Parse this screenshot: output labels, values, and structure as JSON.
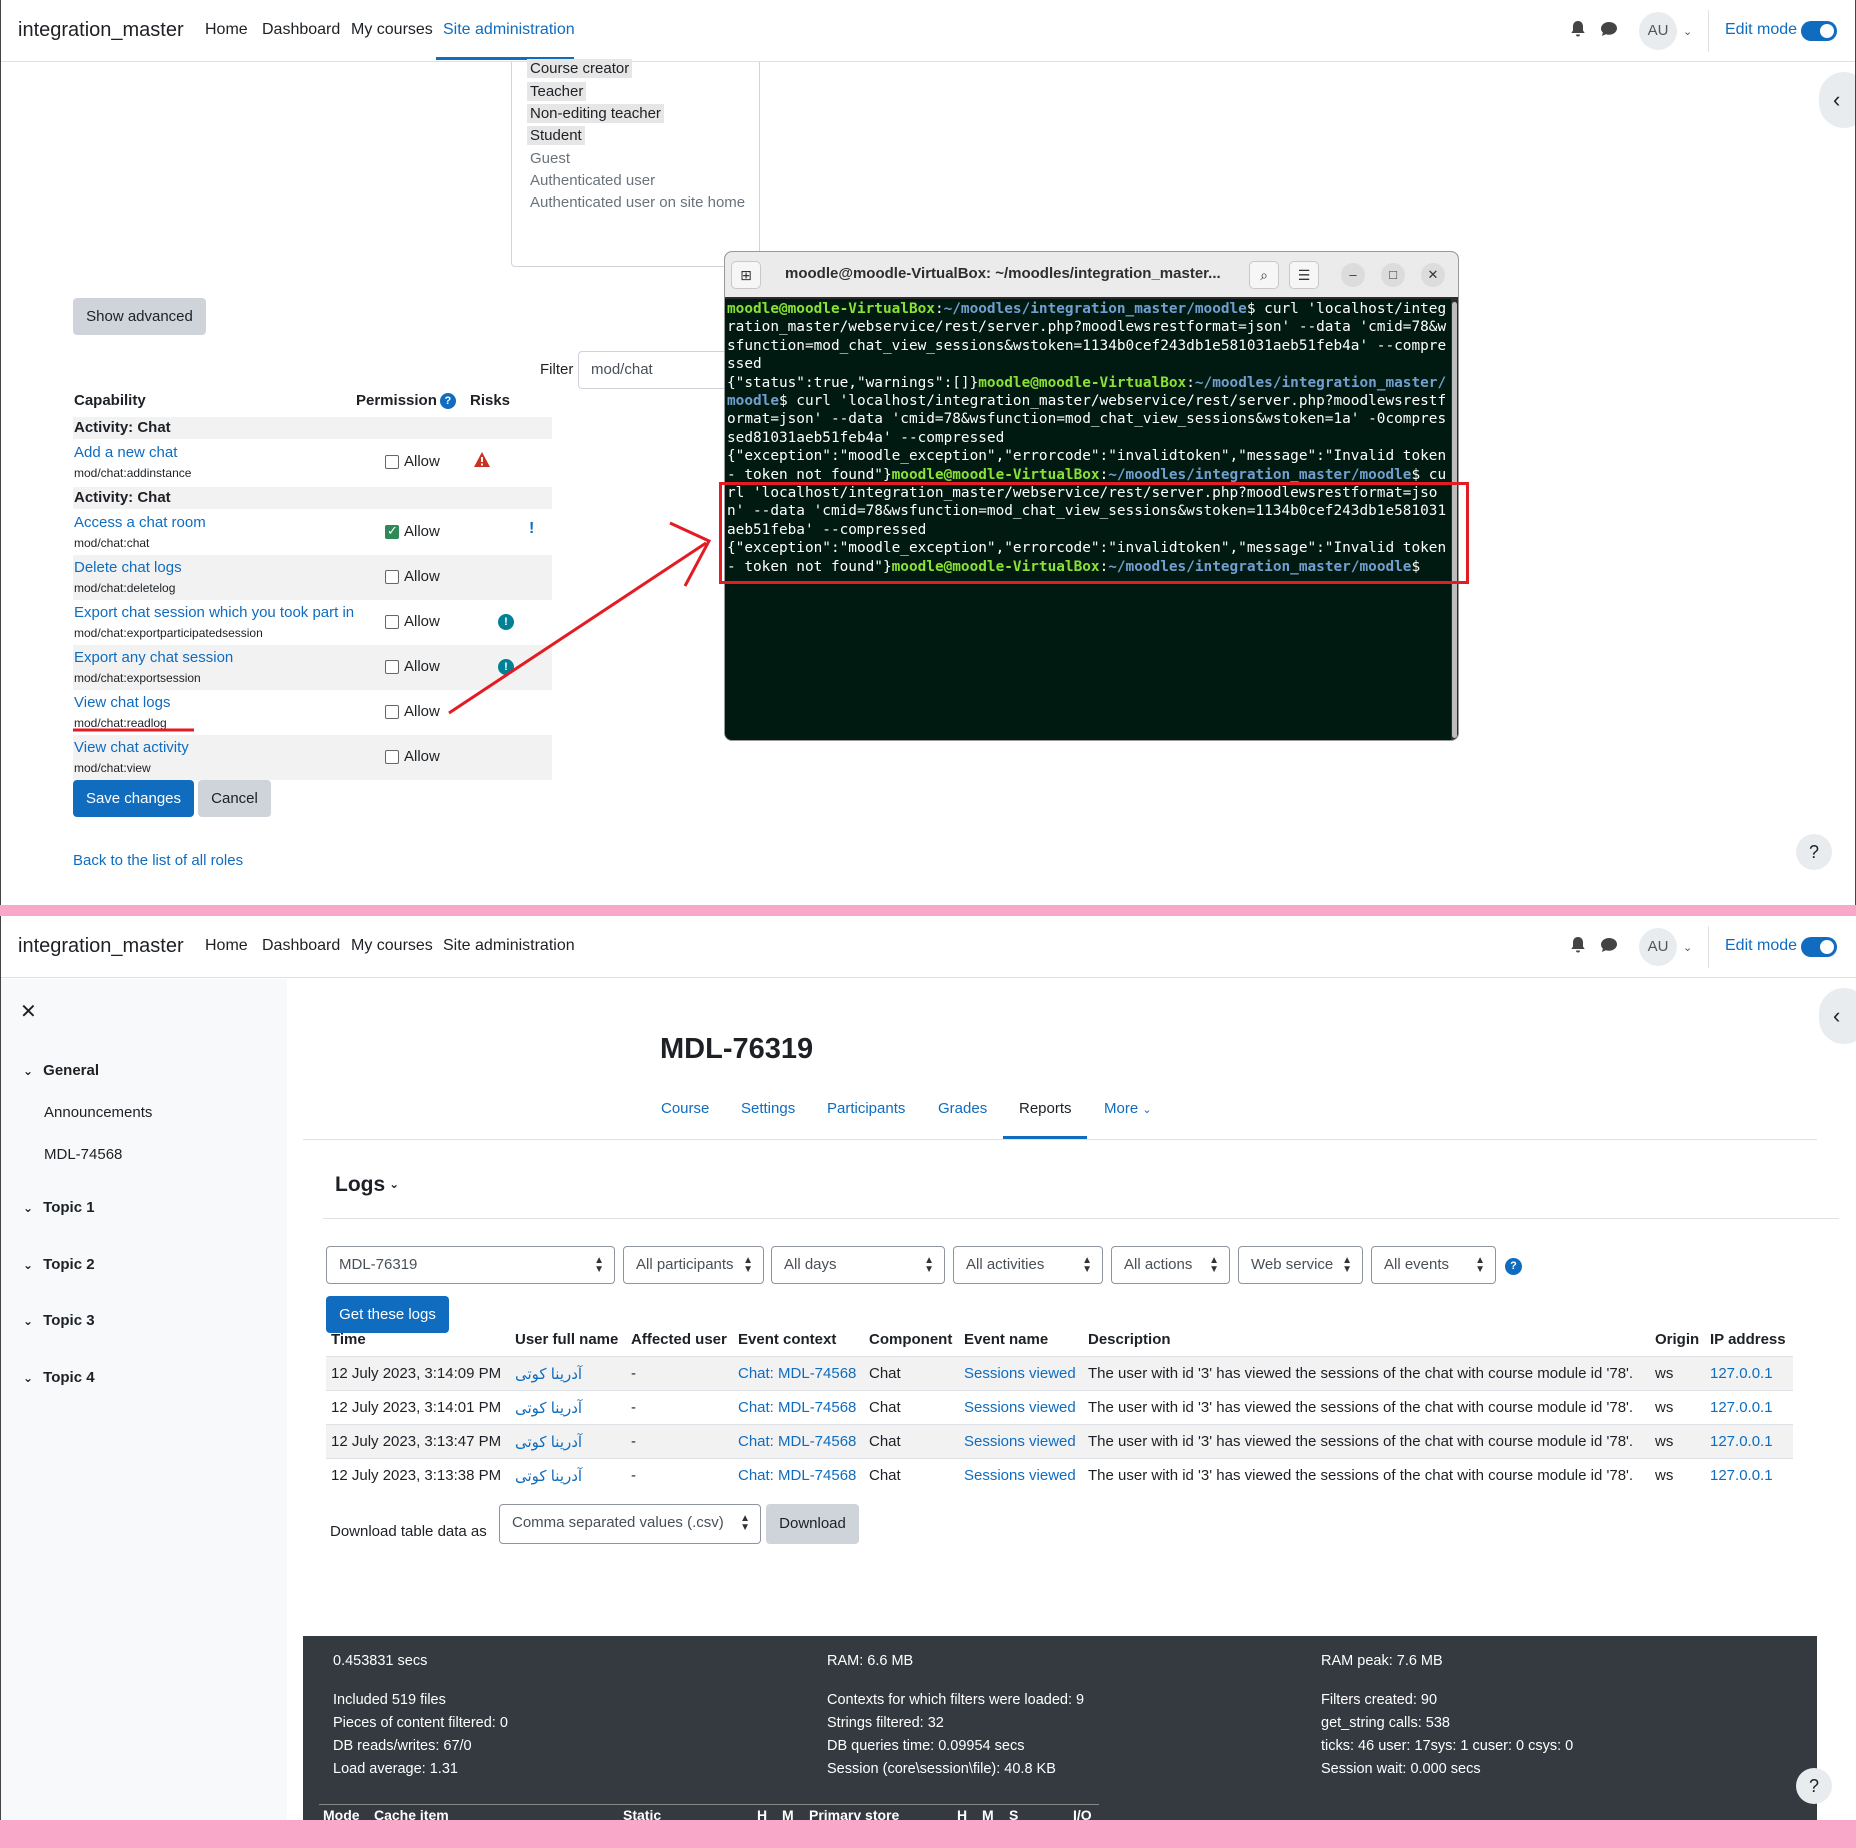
{
  "navbar": {
    "brand": "integration_master",
    "items": [
      "Home",
      "Dashboard",
      "My courses",
      "Site administration"
    ],
    "avatar": "AU",
    "edit_mode": "Edit mode"
  },
  "roles_list": {
    "selected": [
      "Course creator",
      "Teacher",
      "Non-editing teacher",
      "Student"
    ],
    "unselected": [
      "Guest",
      "Authenticated user",
      "Authenticated user on site home"
    ]
  },
  "capabilities": {
    "show_advanced": "Show advanced",
    "filter_label": "Filter",
    "filter_value": "mod/chat",
    "col_capability": "Capability",
    "col_permission": "Permission",
    "col_risks": "Risks",
    "group_label": "Activity: Chat",
    "allow_label": "Allow",
    "rows": [
      {
        "name": "Add a new chat",
        "code": "mod/chat:addinstance",
        "checked": false,
        "risk": "warning"
      },
      {
        "name": "Access a chat room",
        "code": "mod/chat:chat",
        "checked": true,
        "risk": "!"
      },
      {
        "name": "Delete chat logs",
        "code": "mod/chat:deletelog",
        "checked": false,
        "risk": ""
      },
      {
        "name": "Export chat session which you took part in",
        "code": "mod/chat:exportparticipatedsession",
        "checked": false,
        "risk": "info"
      },
      {
        "name": "Export any chat session",
        "code": "mod/chat:exportsession",
        "checked": false,
        "risk": "info"
      },
      {
        "name": "View chat logs",
        "code": "mod/chat:readlog",
        "checked": false,
        "risk": ""
      },
      {
        "name": "View chat activity",
        "code": "mod/chat:view",
        "checked": false,
        "risk": ""
      }
    ],
    "save": "Save changes",
    "cancel": "Cancel",
    "back_link": "Back to the list of all roles"
  },
  "terminal": {
    "title": "moodle@moodle-VirtualBox: ~/moodles/integration_master...",
    "prompt_user": "moodle@moodle-VirtualBox",
    "path_1": "~/moodles/integration_master/moodle",
    "path_2": "~/moodles/integration_master/moodle",
    "cmd_1": "$ curl 'localhost/integration_master/webservice/rest/server.php?moodlewsrestformat=json' --data 'cmid=78&wsfunction=mod_chat_view_sessions&wstoken=1134b0cef243db1e581031aeb51feb4a' --compressed",
    "out_1": "{\"status\":true,\"warnings\":[]}",
    "cmd_2": "$ curl 'localhost/integration_master/webservice/rest/server.php?moodlewsrestformat=json' --data 'cmid=78&wsfunction=mod_chat_view_sessions&wstoken=1a' -0compressed81031aeb51feb4a' --compressed",
    "out_2": "{\"exception\":\"moodle_exception\",\"errorcode\":\"invalidtoken\",\"message\":\"Invalid token - token not found\"}",
    "cmd_3": "$ curl 'localhost/integration_master/webservice/rest/server.php?moodlewsrestformat=json' --data 'cmid=78&wsfunction=mod_chat_view_sessions&wstoken=1134b0cef243db1e581031aeb51feba' --compressed",
    "out_3": "{\"exception\":\"moodle_exception\",\"errorcode\":\"invalidtoken\",\"message\":\"Invalid token - token not found\"}",
    "tail": "$"
  },
  "drawer": {
    "sections": [
      "General",
      "Topic 1",
      "Topic 2",
      "Topic 3",
      "Topic 4"
    ],
    "general_items": [
      "Announcements",
      "MDL-74568"
    ]
  },
  "course": {
    "title": "MDL-76319",
    "tabs": [
      "Course",
      "Settings",
      "Participants",
      "Grades",
      "Reports",
      "More"
    ]
  },
  "logs": {
    "heading": "Logs",
    "filters": [
      "MDL-76319",
      "All participants",
      "All days",
      "All activities",
      "All actions",
      "Web service",
      "All events"
    ],
    "get_button": "Get these logs",
    "columns": [
      "Time",
      "User full name",
      "Affected user",
      "Event context",
      "Component",
      "Event name",
      "Description",
      "Origin",
      "IP address"
    ],
    "rows": [
      {
        "time": "12 July 2023, 3:14:09 PM",
        "user": "آدرینا کوتی",
        "affected": "-",
        "context": "Chat: MDL-74568",
        "component": "Chat",
        "event": "Sessions viewed",
        "description": "The user with id '3' has viewed the sessions of the chat with course module id '78'.",
        "origin": "ws",
        "ip": "127.0.0.1"
      },
      {
        "time": "12 July 2023, 3:14:01 PM",
        "user": "آدرینا کوتی",
        "affected": "-",
        "context": "Chat: MDL-74568",
        "component": "Chat",
        "event": "Sessions viewed",
        "description": "The user with id '3' has viewed the sessions of the chat with course module id '78'.",
        "origin": "ws",
        "ip": "127.0.0.1"
      },
      {
        "time": "12 July 2023, 3:13:47 PM",
        "user": "آدرینا کوتی",
        "affected": "-",
        "context": "Chat: MDL-74568",
        "component": "Chat",
        "event": "Sessions viewed",
        "description": "The user with id '3' has viewed the sessions of the chat with course module id '78'.",
        "origin": "ws",
        "ip": "127.0.0.1"
      },
      {
        "time": "12 July 2023, 3:13:38 PM",
        "user": "آدرینا کوتی",
        "affected": "-",
        "context": "Chat: MDL-74568",
        "component": "Chat",
        "event": "Sessions viewed",
        "description": "The user with id '3' has viewed the sessions of the chat with course module id '78'.",
        "origin": "ws",
        "ip": "127.0.0.1"
      }
    ],
    "download_label": "Download table data as",
    "download_format": "Comma separated values (.csv)",
    "download_button": "Download"
  },
  "footer": {
    "col1": [
      "0.453831 secs",
      "Included 519 files",
      "Pieces of content filtered: 0",
      "DB reads/writes: 67/0",
      "Load average: 1.31"
    ],
    "col2": [
      "RAM: 6.6 MB",
      "Contexts for which filters were loaded: 9",
      "Strings filtered: 32",
      "DB queries time: 0.09954 secs",
      "Session (core\\session\\file): 40.8 KB"
    ],
    "col3": [
      "RAM peak: 7.6 MB",
      "Filters created: 90",
      "get_string calls: 538",
      "ticks: 46 user: 17sys: 1 cuser: 0 csys: 0",
      "Session wait: 0.000 secs"
    ],
    "cache_headers": [
      "Mode",
      "Cache item",
      "Static",
      "H",
      "M",
      "Primary store",
      "H",
      "M",
      "S",
      "I/O"
    ]
  },
  "colors": {
    "accent": "#0f6cbf",
    "annotation": "#e31b23",
    "terminal_bg": "#001a11"
  }
}
